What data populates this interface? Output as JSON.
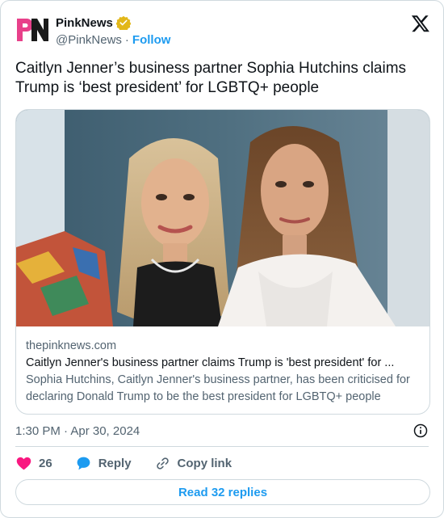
{
  "author": {
    "display_name": "PinkNews",
    "handle": "@PinkNews",
    "separator": "·",
    "follow_label": "Follow",
    "avatar_text": "PN",
    "verified": true,
    "verified_color": "#e2b719",
    "avatar_colors": [
      "#e8408a",
      "#1a1a1a"
    ]
  },
  "platform_icon": "x-logo-icon",
  "tweet": {
    "text": "Caitlyn Jenner’s business partner Sophia Hutchins claims Trump is ‘best president’ for LGBTQ+ people"
  },
  "link_card": {
    "domain": "thepinknews.com",
    "title": "Caitlyn Jenner's business partner claims Trump is 'best president' for ...",
    "description": "Sophia Hutchins, Caitlyn Jenner's business partner, has been criticised for declaring Donald Trump to be the best president for LGBTQ+ people",
    "image_icon": "article-photo"
  },
  "meta": {
    "timestamp": "1:30 PM · Apr 30, 2024"
  },
  "actions": {
    "like_count": "26",
    "reply_label": "Reply",
    "copy_label": "Copy link"
  },
  "footer": {
    "read_replies_label": "Read 32 replies"
  },
  "colors": {
    "accent": "#1d9bf0",
    "like": "#f91880",
    "muted": "#536471",
    "border": "#cfd9de"
  }
}
